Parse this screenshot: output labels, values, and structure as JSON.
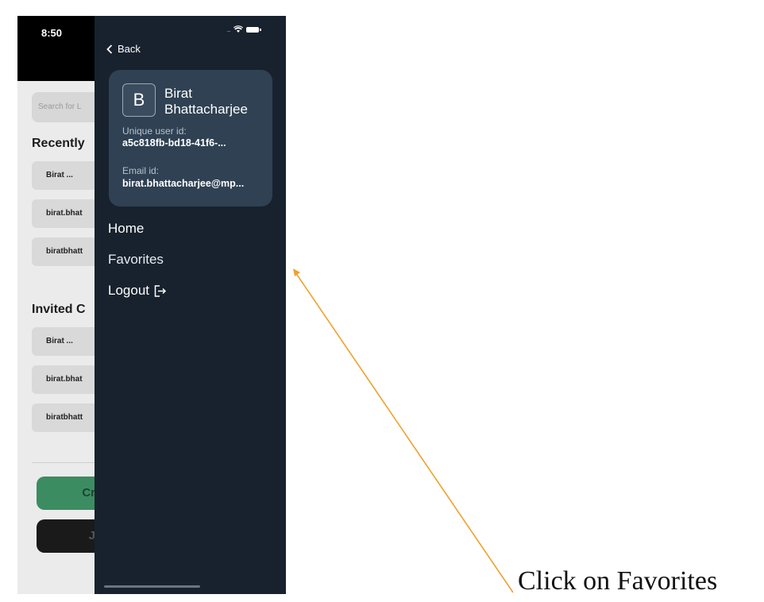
{
  "status_bar": {
    "time": "8:50"
  },
  "background_app": {
    "search_placeholder": "Search for L",
    "recent_heading": "Recently",
    "recent_items": [
      "Birat ...",
      "birat.bhat",
      "biratbhatt"
    ],
    "invited_heading": "Invited C",
    "invited_items": [
      "Birat ...",
      "birat.bhat",
      "biratbhatt"
    ],
    "primary_button_partial": "Cr",
    "secondary_button_partial": "J",
    "colors": {
      "primary_button": "#3c8c62",
      "secondary_button": "#1a1a1a"
    }
  },
  "drawer": {
    "back_label": "Back",
    "profile": {
      "avatar_letter": "B",
      "name": "Birat Bhattacharjee",
      "user_id_label": "Unique user id:",
      "user_id_value": "a5c818fb-bd18-41f6-...",
      "email_label": "Email id:",
      "email_value": "birat.bhattacharjee@mp..."
    },
    "menu": {
      "home": "Home",
      "favorites": "Favorites",
      "logout": "Logout",
      "logout_icon": "logout-icon"
    },
    "colors": {
      "background": "#18222e",
      "card": "#2f4153"
    }
  },
  "annotation": {
    "text": "Click on Favorites",
    "arrow_color": "#f0a030"
  }
}
